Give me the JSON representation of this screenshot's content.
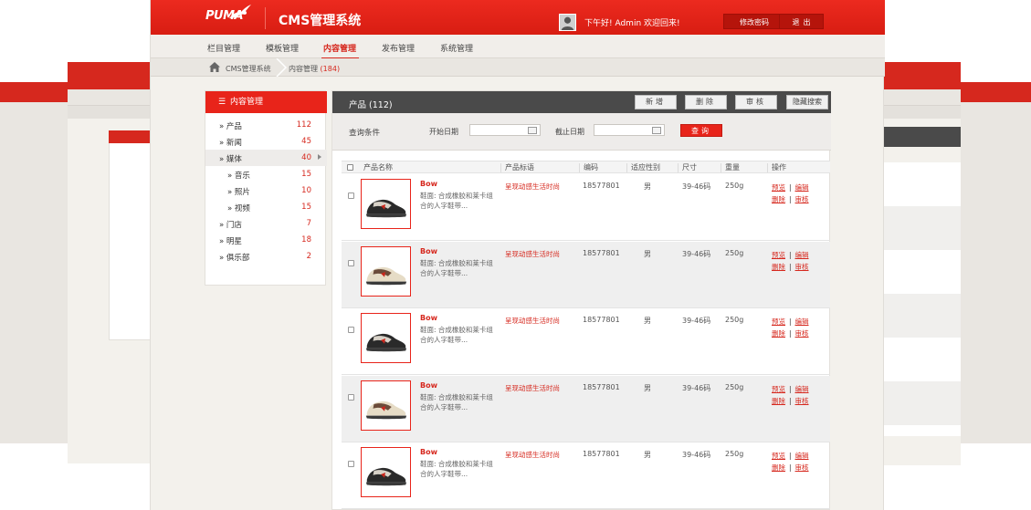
{
  "header": {
    "brand": "PUMA",
    "app_title": "CMS管理系统",
    "greeting": "下午好! Admin 欢迎回来!",
    "change_password": "修改密码",
    "logout": "退出"
  },
  "nav": {
    "items": [
      "栏目管理",
      "模板管理",
      "内容管理",
      "发布管理",
      "系统管理"
    ],
    "active": "内容管理"
  },
  "breadcrumb": {
    "root": "CMS管理系统",
    "current": "内容管理",
    "count": "(184)"
  },
  "sidebar": {
    "title": "内容管理",
    "items": [
      {
        "label": "» 产品",
        "count": "112"
      },
      {
        "label": "» 新闻",
        "count": "45"
      },
      {
        "label": "» 媒体",
        "count": "40"
      },
      {
        "label": "» 音乐",
        "count": "15"
      },
      {
        "label": "» 照片",
        "count": "10"
      },
      {
        "label": "» 视频",
        "count": "15"
      },
      {
        "label": "» 门店",
        "count": "7"
      },
      {
        "label": "» 明星",
        "count": "18"
      },
      {
        "label": "» 俱乐部",
        "count": "2"
      }
    ]
  },
  "content": {
    "title": "产品 (112)",
    "buttons": {
      "add": "新增",
      "delete": "删除",
      "review": "审核",
      "hide_search": "隐藏搜索"
    },
    "query": {
      "label": "查询条件",
      "start_date": "开始日期",
      "end_date": "截止日期",
      "submit": "查询"
    },
    "columns": [
      "产品名称",
      "产品标语",
      "编码",
      "适应性别",
      "尺寸",
      "重量",
      "操作"
    ],
    "rows": [
      {
        "name": "Bow",
        "desc": "鞋面: 合成橡胶和莱卡组合的人字鞋带...",
        "slogan": "呈现动感生活时尚",
        "code": "18577801",
        "gender": "男",
        "size": "39-46码",
        "weight": "250g",
        "shoe": "black"
      },
      {
        "name": "Bow",
        "desc": "鞋面: 合成橡胶和莱卡组合的人字鞋带...",
        "slogan": "呈现动感生活时尚",
        "code": "18577801",
        "gender": "男",
        "size": "39-46码",
        "weight": "250g",
        "shoe": "beige"
      },
      {
        "name": "Bow",
        "desc": "鞋面: 合成橡胶和莱卡组合的人字鞋带...",
        "slogan": "呈现动感生活时尚",
        "code": "18577801",
        "gender": "男",
        "size": "39-46码",
        "weight": "250g",
        "shoe": "black"
      },
      {
        "name": "Bow",
        "desc": "鞋面: 合成橡胶和莱卡组合的人字鞋带...",
        "slogan": "呈现动感生活时尚",
        "code": "18577801",
        "gender": "男",
        "size": "39-46码",
        "weight": "250g",
        "shoe": "beige"
      },
      {
        "name": "Bow",
        "desc": "鞋面: 合成橡胶和莱卡组合的人字鞋带...",
        "slogan": "呈现动感生活时尚",
        "code": "18577801",
        "gender": "男",
        "size": "39-46码",
        "weight": "250g",
        "shoe": "black"
      }
    ],
    "actions": {
      "preview": "预览",
      "edit": "编辑",
      "delete": "删除",
      "review": "审核"
    }
  },
  "colors": {
    "brand_red": "#e8241a",
    "dark_header": "#4a4a4a",
    "page_bg": "#f3f1ec"
  }
}
